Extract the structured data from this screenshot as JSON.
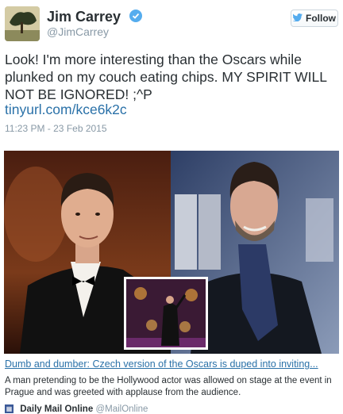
{
  "author": {
    "name": "Jim Carrey",
    "handle": "@JimCarrey"
  },
  "follow_label": "Follow",
  "tweet": {
    "text": "Look! I'm more interesting than the Oscars while plunked on my couch eating chips. MY SPIRIT WILL NOT BE IGNORED! ;^P",
    "link": "tinyurl.com/kce6k2c",
    "timestamp": "11:23 PM - 23 Feb 2015"
  },
  "card": {
    "title": "Dumb and dumber: Czech version of the Oscars is duped into inviting...",
    "description": "A man pretending to be the Hollywood actor was allowed on stage at the event in Prague and was greeted with applause from the audience.",
    "source_name": "Daily Mail Online",
    "source_handle": "@MailOnline"
  },
  "icons": {
    "verified": "verified-badge-icon",
    "follow": "twitter-bird-icon",
    "source": "daily-mail-icon"
  },
  "colors": {
    "link": "#2a71a8",
    "verified": "#55acee",
    "muted": "#8899a6",
    "text": "#292f33"
  }
}
